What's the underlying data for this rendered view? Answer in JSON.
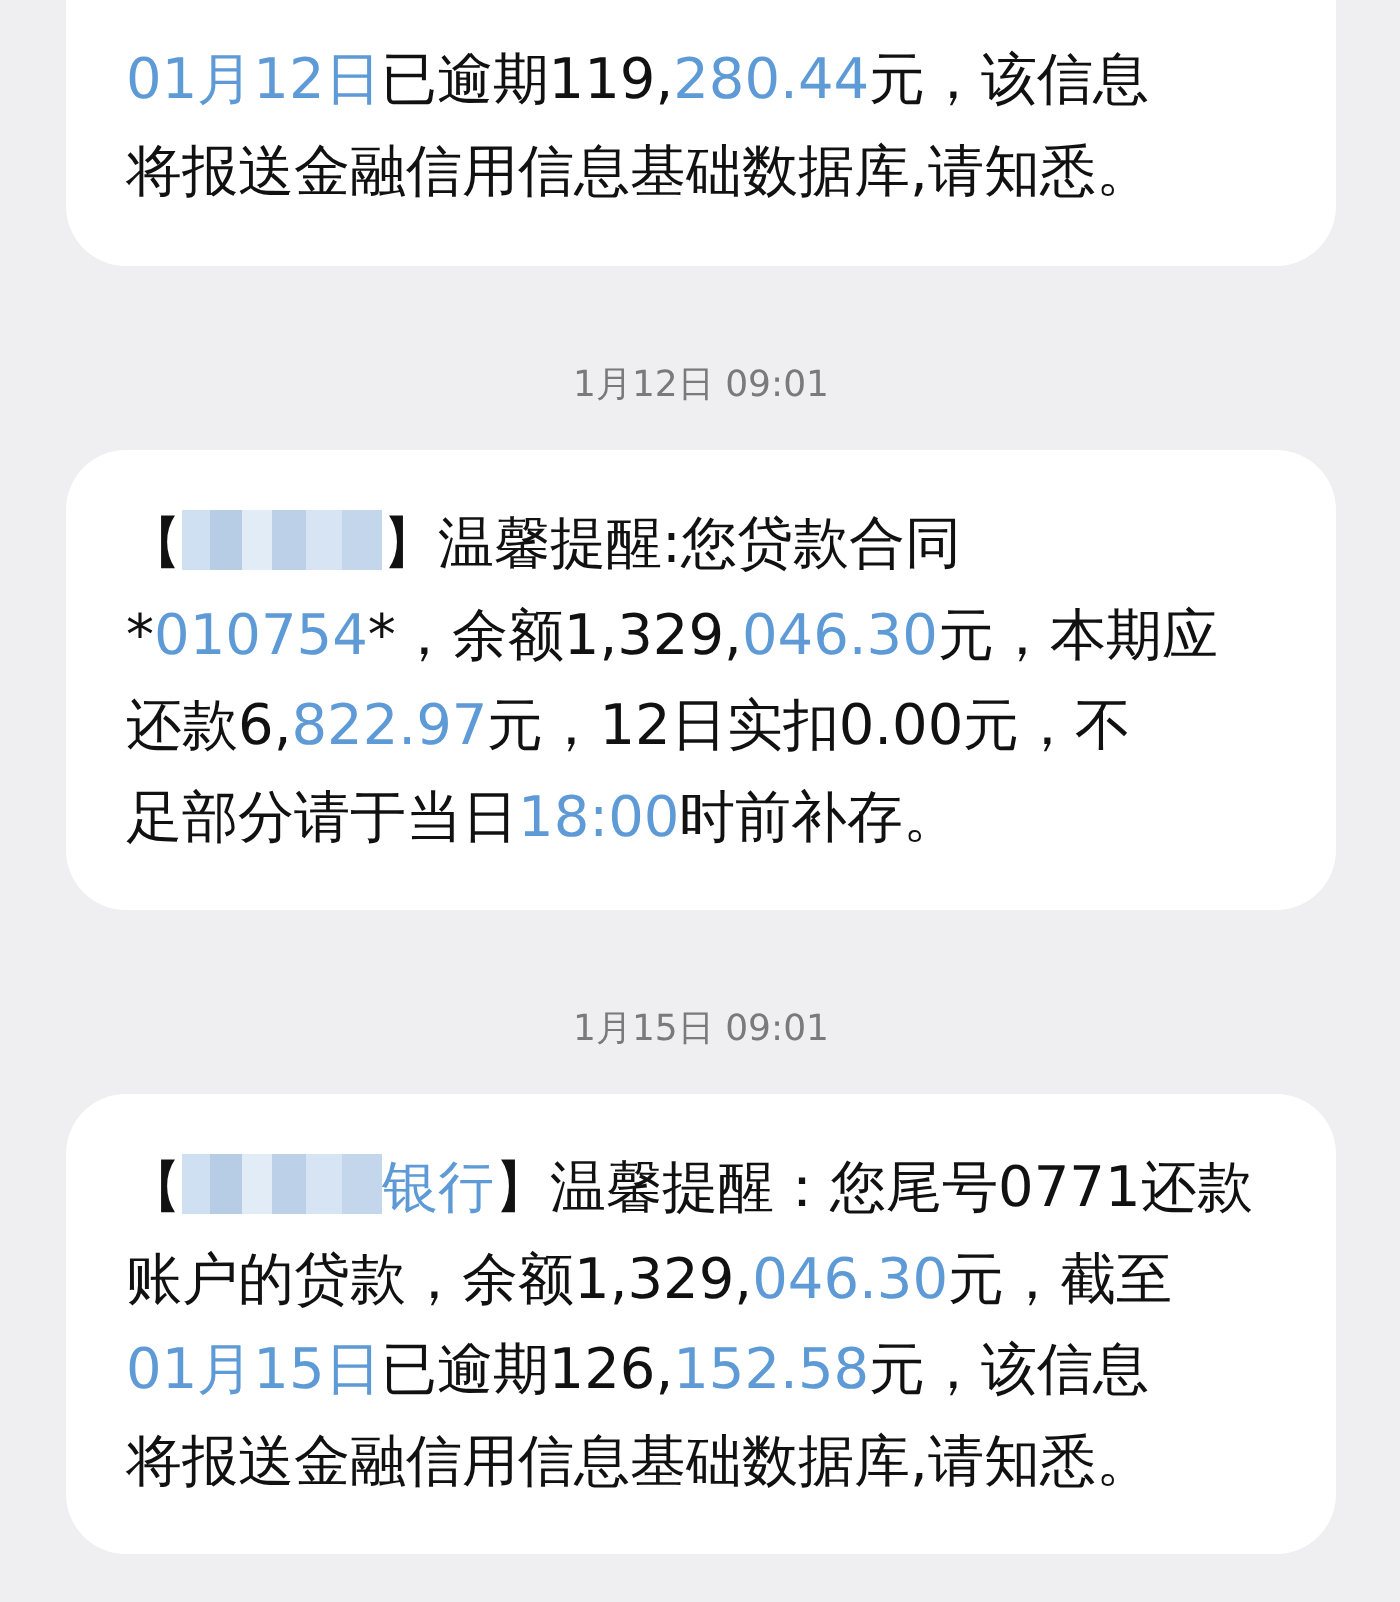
{
  "messages": [
    {
      "kind": "message",
      "segments": [
        {
          "kind": "link",
          "text": "01月12日"
        },
        {
          "kind": "text",
          "text": "已逾期119,"
        },
        {
          "kind": "link",
          "text": "280.44"
        },
        {
          "kind": "text",
          "text": "元，该信息"
        },
        {
          "kind": "break"
        },
        {
          "kind": "text",
          "text": "将报送金融信用信息基础数据库,请知悉。"
        }
      ]
    },
    {
      "kind": "timestamp",
      "text": "1月12日 09:01"
    },
    {
      "kind": "message",
      "segments": [
        {
          "kind": "text",
          "text": "【"
        },
        {
          "kind": "redacted"
        },
        {
          "kind": "text",
          "text": "】温馨提醒:您贷款合同"
        },
        {
          "kind": "break"
        },
        {
          "kind": "text",
          "text": "*"
        },
        {
          "kind": "link",
          "text": "010754"
        },
        {
          "kind": "text",
          "text": "*，余额1,329,"
        },
        {
          "kind": "link",
          "text": "046.30"
        },
        {
          "kind": "text",
          "text": "元，本期应"
        },
        {
          "kind": "break"
        },
        {
          "kind": "text",
          "text": "还款6,"
        },
        {
          "kind": "link",
          "text": "822.97"
        },
        {
          "kind": "text",
          "text": "元，12日实扣0.00元，不"
        },
        {
          "kind": "break"
        },
        {
          "kind": "text",
          "text": "足部分请于当日"
        },
        {
          "kind": "link",
          "text": "18:00"
        },
        {
          "kind": "text",
          "text": "时前补存。"
        }
      ]
    },
    {
      "kind": "timestamp",
      "text": "1月15日 09:01"
    },
    {
      "kind": "message",
      "segments": [
        {
          "kind": "text",
          "text": "【"
        },
        {
          "kind": "redacted"
        },
        {
          "kind": "link",
          "text": "银行"
        },
        {
          "kind": "text",
          "text": "】温馨提醒：您尾号0771还款"
        },
        {
          "kind": "break"
        },
        {
          "kind": "text",
          "text": "账户的贷款，余额1,329,"
        },
        {
          "kind": "link",
          "text": "046.30"
        },
        {
          "kind": "text",
          "text": "元，截至"
        },
        {
          "kind": "break"
        },
        {
          "kind": "link",
          "text": "01月15日"
        },
        {
          "kind": "text",
          "text": "已逾期126,"
        },
        {
          "kind": "link",
          "text": "152.58"
        },
        {
          "kind": "text",
          "text": "元，该信息"
        },
        {
          "kind": "break"
        },
        {
          "kind": "text",
          "text": "将报送金融信用信息基础数据库,请知悉。"
        }
      ]
    }
  ]
}
